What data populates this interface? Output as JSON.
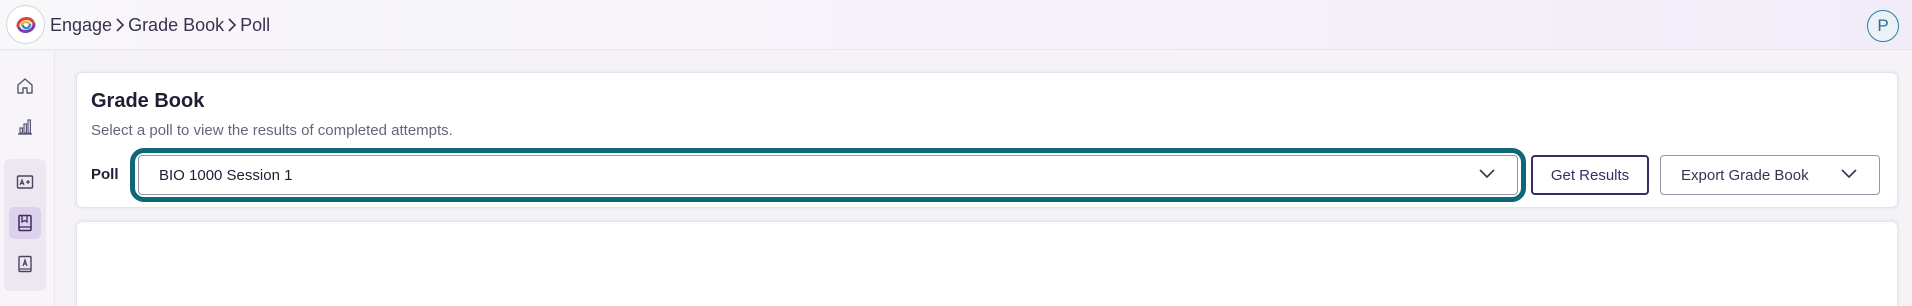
{
  "app": {
    "logo_icon": "swirl-logo-icon",
    "breadcrumb": [
      "Engage",
      "Grade Book",
      "Poll"
    ],
    "user_initial": "P"
  },
  "sidebar": {
    "items": [
      {
        "icon": "home-icon",
        "active": false
      },
      {
        "icon": "bar-chart-icon",
        "active": false
      },
      {
        "icon": "grade-card-icon",
        "active": false
      },
      {
        "icon": "gradebook-icon",
        "active": true
      },
      {
        "icon": "address-book-icon",
        "active": false
      }
    ]
  },
  "gradebook": {
    "title": "Grade Book",
    "subtitle": "Select a poll to view the results of completed attempts.",
    "poll_label": "Poll",
    "selected_poll": "BIO 1000 Session 1",
    "get_results_label": "Get Results",
    "export_label": "Export Grade Book"
  },
  "colors": {
    "accent": "#3e2a66",
    "focus_ring": "#0e6878",
    "sidebar_active": "#ddd2ec"
  }
}
